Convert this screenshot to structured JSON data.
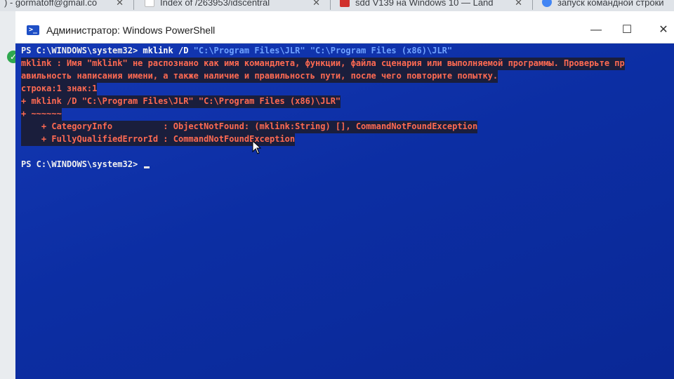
{
  "browser_tabs": [
    {
      "label": ") - gormatoff@gmail.co",
      "favicon": "gmail-icon",
      "color": "#d93025"
    },
    {
      "label": "Index of /263953/idscentral",
      "favicon": "page-icon",
      "color": "#ffffff"
    },
    {
      "label": "sdd V139 на Windows 10 — Land",
      "favicon": "drive2-icon",
      "color": "#d0312d"
    },
    {
      "label": "запуск командной строки",
      "favicon": "google-icon",
      "color": "#4285f4"
    }
  ],
  "window": {
    "title": "Администратор: Windows PowerShell",
    "minimize": "—",
    "maximize": "☐",
    "close": "✕"
  },
  "console": {
    "line1_prompt": "PS C:\\WINDOWS\\system32> ",
    "line1_cmd": "mklink /D ",
    "line1_arg1": "\"C:\\Program Files\\JLR\"",
    "line1_space": " ",
    "line1_arg2": "\"C:\\Program Files (x86)\\JLR\"",
    "err1": "mklink : Имя \"mklink\" не распознано как имя командлета, функции, файла сценария или выполняемой программы. Проверьте пр",
    "err2": "авильность написания имени, а также наличие и правильность пути, после чего повторите попытку.",
    "err3": "строка:1 знак:1",
    "err4": "+ mklink /D \"C:\\Program Files\\JLR\" \"C:\\Program Files (x86)\\JLR\"",
    "err5": "+ ~~~~~~",
    "err6": "    + CategoryInfo          : ObjectNotFound: (mklink:String) [], CommandNotFoundException",
    "err7": "    + FullyQualifiedErrorId : CommandNotFoundException",
    "prompt2": "PS C:\\WINDOWS\\system32> "
  },
  "colors": {
    "console_bg": "#0f32a8",
    "error_text": "#ff6a52",
    "string_text": "#6fa2ff"
  }
}
